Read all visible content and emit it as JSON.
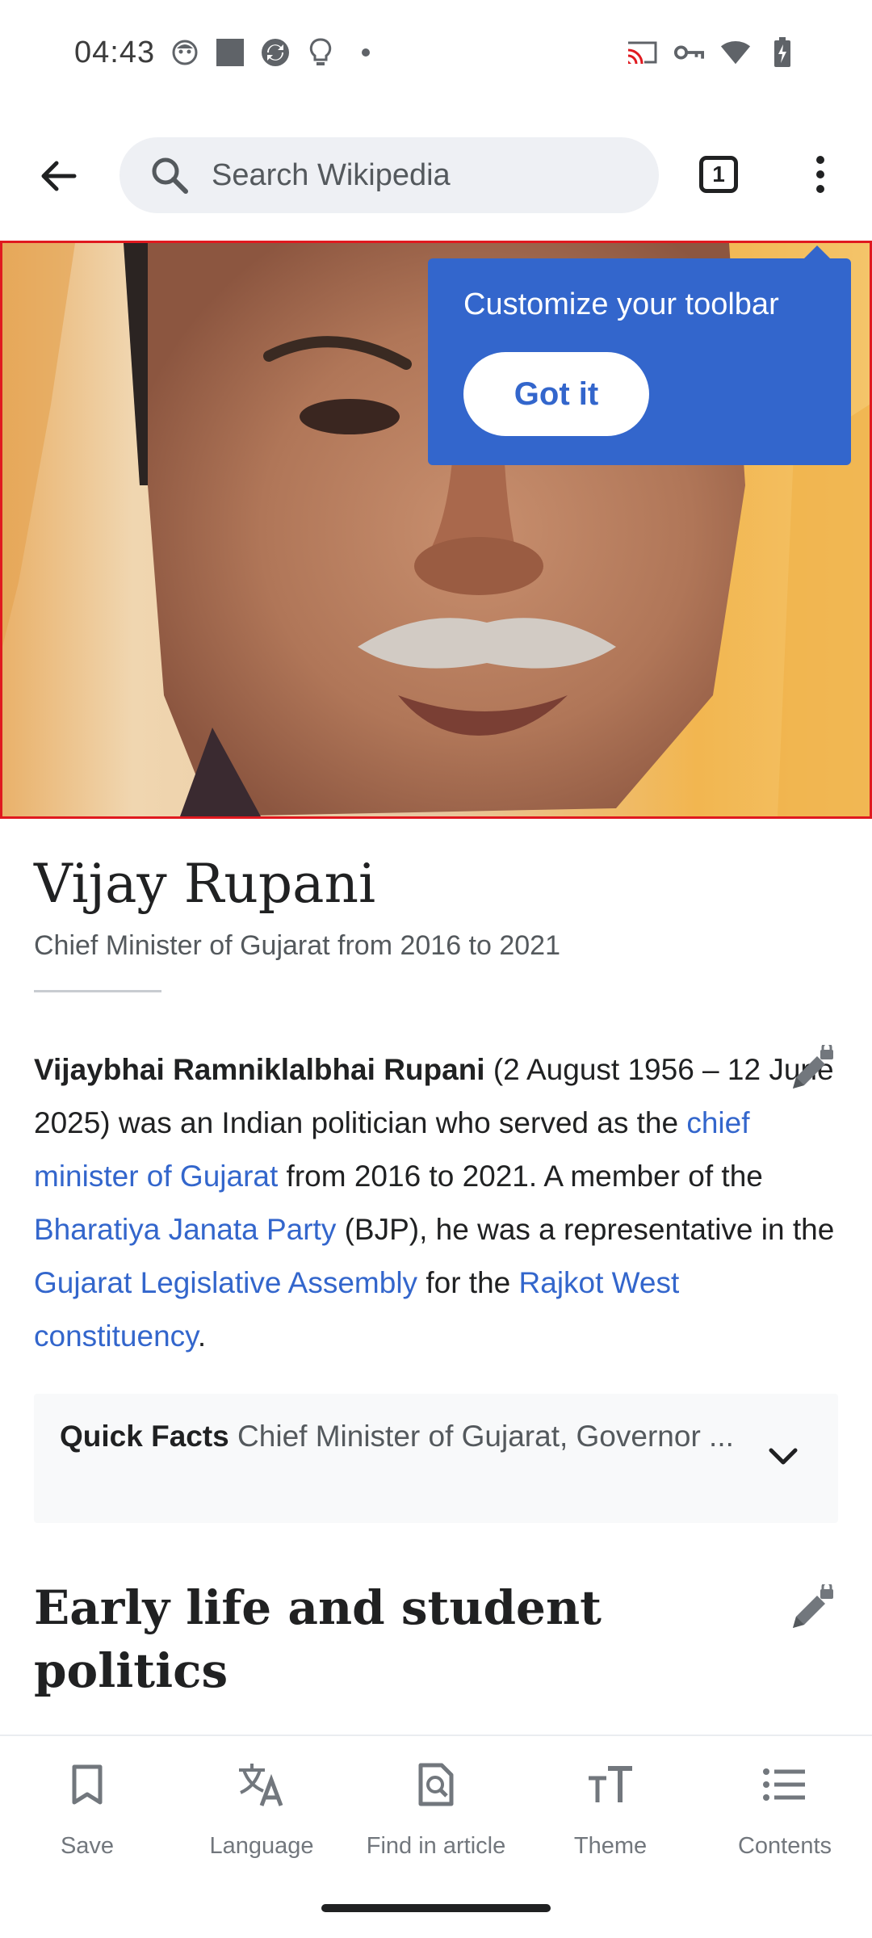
{
  "status_bar": {
    "time": "04:43",
    "left_icons": [
      "face-notification-icon",
      "square-notification-icon",
      "sync-notification-icon",
      "lightbulb-notification-icon",
      "more-dot-icon"
    ],
    "right_icons": [
      "cast-icon",
      "vpn-key-icon",
      "wifi-icon",
      "battery-charging-icon"
    ]
  },
  "app_bar": {
    "search_placeholder": "Search Wikipedia",
    "tab_count": "1"
  },
  "tooltip": {
    "title": "Customize your toolbar",
    "button_label": "Got it"
  },
  "article": {
    "title": "Vijay Rupani",
    "description": "Chief Minister of Gujarat from 2016 to 2021",
    "lead": {
      "bold_name": "Vijaybhai Ramniklalbhai Rupani",
      "text_1": " (2 August 1956 – 12 June 2025) was an Indian politician who served as the ",
      "link_1": "chief minister of Gujarat",
      "text_2": " from 2016 to 2021. A member of the ",
      "link_2": "Bharatiya Janata Party",
      "text_3": " (BJP), he was a representative in the ",
      "link_3": "Gujarat Legislative Assembly",
      "text_4": " for the ",
      "link_4": "Rajkot West constituency",
      "text_5": "."
    },
    "quick_facts": {
      "label": "Quick Facts",
      "text": " Chief Minister of Gujarat, Governor ..."
    },
    "section_heading": "Early life and student politics"
  },
  "toolbar": {
    "items": [
      {
        "label": "Save",
        "icon": "bookmark-icon"
      },
      {
        "label": "Language",
        "icon": "translate-icon"
      },
      {
        "label": "Find in article",
        "icon": "find-in-page-icon"
      },
      {
        "label": "Theme",
        "icon": "text-size-icon"
      },
      {
        "label": "Contents",
        "icon": "list-icon"
      }
    ]
  },
  "colors": {
    "accent": "#3366cc",
    "text": "#202122",
    "secondary_text": "#54595d",
    "image_highlight_border": "#e0191f"
  }
}
